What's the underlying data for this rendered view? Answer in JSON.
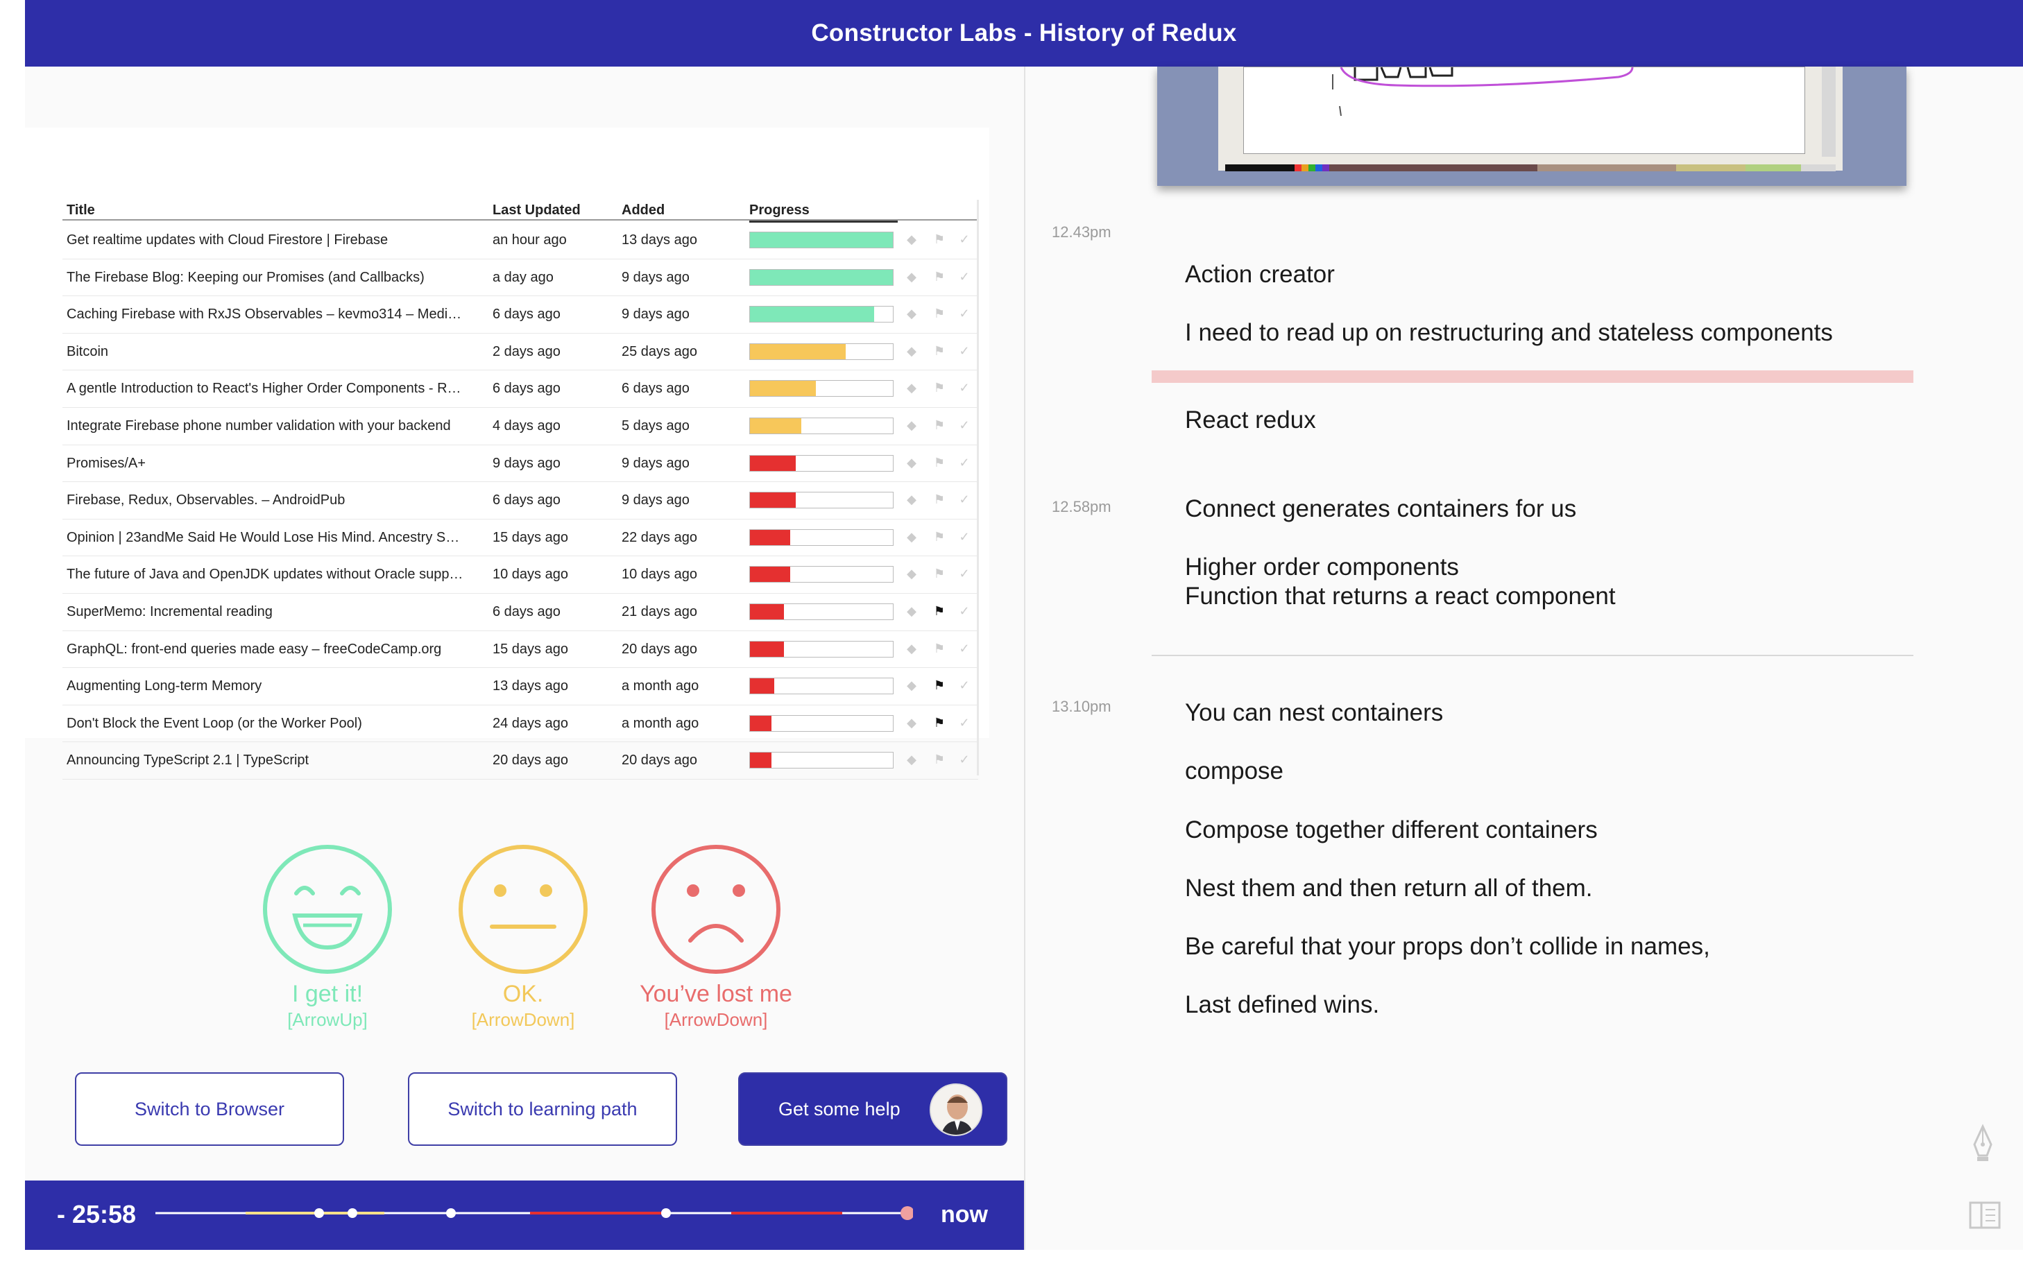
{
  "header": {
    "title": "Constructor Labs - History of Redux"
  },
  "table": {
    "columns": [
      "Title",
      "Last Updated",
      "Added",
      "Progress"
    ],
    "rows": [
      {
        "title": "Get realtime updates with Cloud Firestore  |  Firebase",
        "updated": "an hour ago",
        "added": "13 days ago",
        "progress": 1.0,
        "color": "#7ee8b8",
        "flagged": false
      },
      {
        "title": "The Firebase Blog: Keeping our Promises (and Callbacks)",
        "updated": "a day ago",
        "added": "9 days ago",
        "progress": 1.0,
        "color": "#7ee8b8",
        "flagged": false
      },
      {
        "title": "Caching Firebase with RxJS Observables – kevmo314 – Medi…",
        "updated": "6 days ago",
        "added": "9 days ago",
        "progress": 0.87,
        "color": "#7ee8b8",
        "flagged": false
      },
      {
        "title": "Bitcoin",
        "updated": "2 days ago",
        "added": "25 days ago",
        "progress": 0.67,
        "color": "#f7c75a",
        "flagged": false
      },
      {
        "title": "A gentle Introduction to React's Higher Order Components - R…",
        "updated": "6 days ago",
        "added": "6 days ago",
        "progress": 0.46,
        "color": "#f7c75a",
        "flagged": false
      },
      {
        "title": "Integrate Firebase phone number validation with your backend",
        "updated": "4 days ago",
        "added": "5 days ago",
        "progress": 0.36,
        "color": "#f7c75a",
        "flagged": false
      },
      {
        "title": "Promises/A+",
        "updated": "9 days ago",
        "added": "9 days ago",
        "progress": 0.32,
        "color": "#e53030",
        "flagged": false
      },
      {
        "title": "Firebase, Redux, Observables. – AndroidPub",
        "updated": "6 days ago",
        "added": "9 days ago",
        "progress": 0.32,
        "color": "#e53030",
        "flagged": false
      },
      {
        "title": "Opinion | 23andMe Said He Would Lose His Mind. Ancestry S…",
        "updated": "15 days ago",
        "added": "22 days ago",
        "progress": 0.28,
        "color": "#e53030",
        "flagged": false
      },
      {
        "title": "The future of Java and OpenJDK updates without Oracle supp…",
        "updated": "10 days ago",
        "added": "10 days ago",
        "progress": 0.28,
        "color": "#e53030",
        "flagged": false
      },
      {
        "title": "SuperMemo: Incremental reading",
        "updated": "6 days ago",
        "added": "21 days ago",
        "progress": 0.24,
        "color": "#e53030",
        "flagged": true
      },
      {
        "title": "GraphQL: front-end queries made easy – freeCodeCamp.org",
        "updated": "15 days ago",
        "added": "20 days ago",
        "progress": 0.24,
        "color": "#e53030",
        "flagged": false
      },
      {
        "title": "Augmenting Long-term Memory",
        "updated": "13 days ago",
        "added": "a month ago",
        "progress": 0.17,
        "color": "#e53030",
        "flagged": true
      },
      {
        "title": "Don't Block the Event Loop (or the Worker Pool)",
        "updated": "24 days ago",
        "added": "a month ago",
        "progress": 0.15,
        "color": "#e53030",
        "flagged": true
      },
      {
        "title": "Announcing TypeScript 2.1 | TypeScript",
        "updated": "20 days ago",
        "added": "20 days ago",
        "progress": 0.15,
        "color": "#e53030",
        "flagged": false
      }
    ]
  },
  "feedback": [
    {
      "label": "I get it!",
      "key": "[ArrowUp]",
      "color": "#7ee8b8"
    },
    {
      "label": "OK.",
      "key": "[ArrowDown]",
      "color": "#f2c85a"
    },
    {
      "label": "You’ve lost me",
      "key": "[ArrowDown]",
      "color": "#e86c6c"
    }
  ],
  "buttons": {
    "browser": "Switch to Browser",
    "learning": "Switch to learning path",
    "help": "Get some help"
  },
  "timeline": {
    "elapsed": "- 25:58",
    "now": "now"
  },
  "notes": {
    "ts1": "12.43pm",
    "ts2": "12.58pm",
    "ts3": "13.10pm",
    "n1": "Action creator",
    "n2": "I need to read up on restructuring and stateless components",
    "n3": "React redux",
    "n4": "Connect generates containers for us",
    "n5": "Higher order components",
    "n6": "Function that returns a react component",
    "n7": "You can nest containers",
    "n8": "compose",
    "n9": "Compose together different containers",
    "n10": "Nest them and then return all of them.",
    "n11": "Be careful that your props don’t collide in names,",
    "n12": "Last defined wins."
  },
  "colors": {
    "brand": "#2e2ea8",
    "green": "#7ee8b8",
    "yellow": "#f7c75a",
    "red": "#e53030"
  }
}
